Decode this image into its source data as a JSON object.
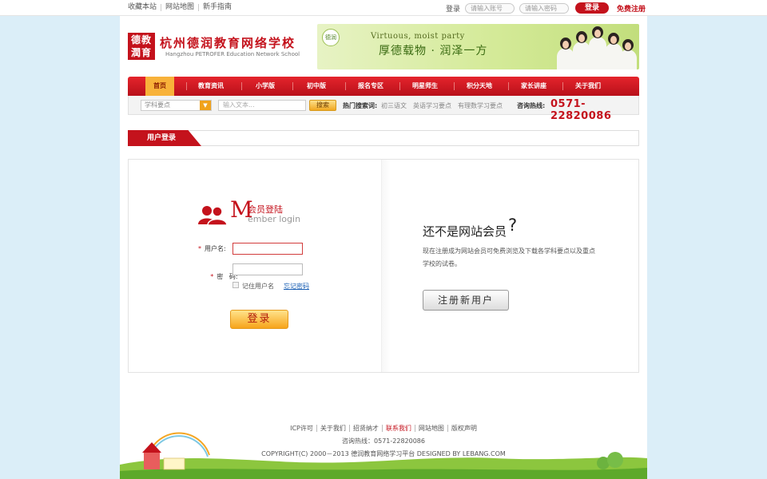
{
  "topbar": {
    "links": [
      "收藏本站",
      "网站地图",
      "新手指南"
    ],
    "login_label": "登录",
    "account_placeholder": "请输入账号",
    "password_placeholder": "请输入密码",
    "login_button": "登录",
    "register_link": "免费注册"
  },
  "header": {
    "seal_text": "德教潤育",
    "title": "杭州德润教育网络学校",
    "subtitle": "Hangzhou PETROFER Education Network School",
    "banner_seal": "德润",
    "banner_en": "Virtuous, moist party",
    "banner_cn": "厚德载物 · 润泽一方"
  },
  "nav": {
    "items": [
      "首页",
      "教育资讯",
      "小学版",
      "初中版",
      "报名专区",
      "明星师生",
      "积分天地",
      "家长讲座",
      "关于我们"
    ],
    "active_index": 0
  },
  "search": {
    "select_value": "学科要点",
    "keyword_placeholder": "输入文本...",
    "button": "搜索",
    "hot_label": "热门搜索词:",
    "hot_words": [
      "初三语文",
      "英语学习要点",
      "有理数学习要点"
    ],
    "hotline_label": "咨询热线:",
    "hotline": "0571-22820086"
  },
  "section": {
    "title": "用户登录"
  },
  "login": {
    "M": "M",
    "title_cn": "会员登陆",
    "title_en": "ember login",
    "username_label": "用户名:",
    "password_label": "密   码:",
    "remember": "记住用户名",
    "forgot": "忘记密码",
    "submit": "登录"
  },
  "register": {
    "title": "还不是网站会员",
    "question": "?",
    "desc": "现在注册成为网站会员可免费浏览及下载各学科要点以及重点学校的试卷。",
    "button": "注册新用户"
  },
  "footer": {
    "links": [
      "ICP许可",
      "关于我们",
      "招贤纳才",
      "联系我们",
      "网站地图",
      "版权声明"
    ],
    "highlight_index": 3,
    "phone": "咨询热线：0571-22820086",
    "copyright": "COPYRIGHT(C) 2000－2013 德润教育网络学习平台   DESIGNED BY LEBANG.COM"
  },
  "colors": {
    "brand_red": "#c4121c",
    "nav_active": "#f8b23a",
    "page_bg": "#dbeef8"
  }
}
